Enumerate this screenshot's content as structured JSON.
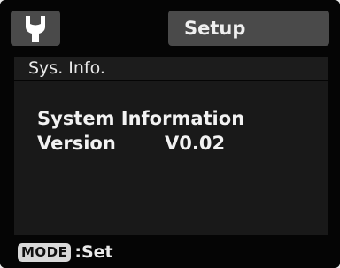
{
  "header": {
    "tool_icon": "wrench-icon",
    "tab_label": "Setup"
  },
  "section": {
    "title": "Sys. Info."
  },
  "info": {
    "title": "System Information",
    "version_label": "Version",
    "version_value": "V0.02"
  },
  "footer": {
    "mode_key": "MODE",
    "action_label": ":Set"
  }
}
